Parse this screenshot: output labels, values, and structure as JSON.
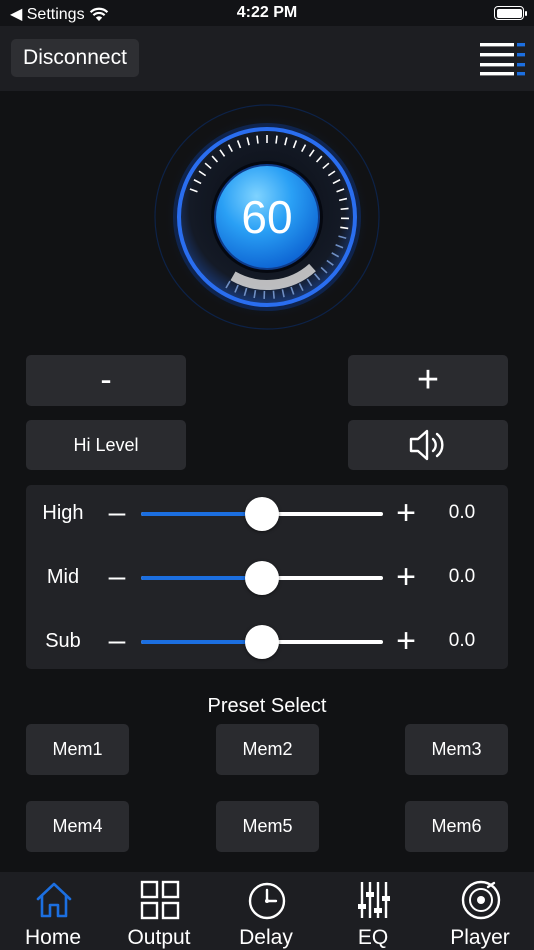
{
  "status_bar": {
    "back_label": "◀ Settings",
    "time": "4:22 PM"
  },
  "header": {
    "disconnect_label": "Disconnect",
    "menu_icon": "menu-icon"
  },
  "volume": {
    "value": "60",
    "level_fraction": 0.6
  },
  "controls": {
    "minus_label": "-",
    "plus_label": "+",
    "hilevel_label": "Hi Level",
    "speaker_icon": "speaker-icon"
  },
  "tone": [
    {
      "label": "High",
      "minus": "–",
      "plus": "+",
      "value": "0.0",
      "fraction": 0.5
    },
    {
      "label": "Mid",
      "minus": "–",
      "plus": "+",
      "value": "0.0",
      "fraction": 0.5
    },
    {
      "label": "Sub",
      "minus": "–",
      "plus": "+",
      "value": "0.0",
      "fraction": 0.5
    }
  ],
  "presets": {
    "title": "Preset Select",
    "items": [
      "Mem1",
      "Mem2",
      "Mem3",
      "Mem4",
      "Mem5",
      "Mem6"
    ]
  },
  "tabs": [
    {
      "label": "Home",
      "icon": "home-icon",
      "active": true
    },
    {
      "label": "Output",
      "icon": "grid-icon",
      "active": false
    },
    {
      "label": "Delay",
      "icon": "clock-icon",
      "active": false
    },
    {
      "label": "EQ",
      "icon": "equalizer-icon",
      "active": false
    },
    {
      "label": "Player",
      "icon": "record-icon",
      "active": false
    }
  ],
  "colors": {
    "accent": "#1c6fe0",
    "background": "#111214",
    "panel": "#222327",
    "button": "#2a2b2f"
  }
}
